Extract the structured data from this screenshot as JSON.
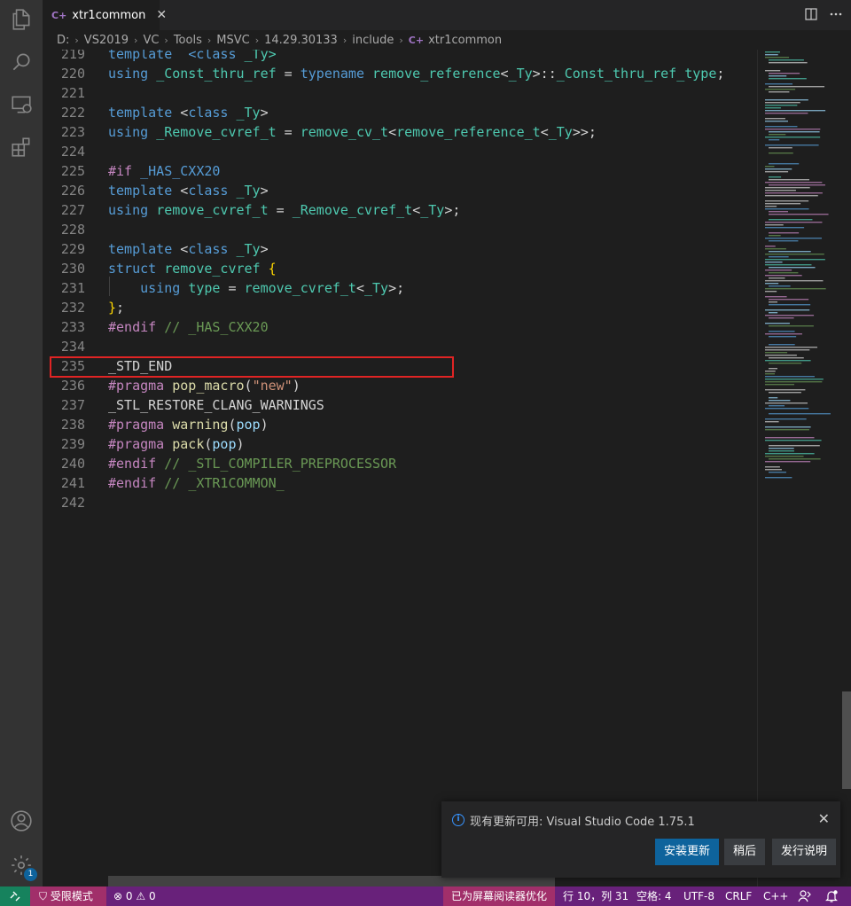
{
  "tab": {
    "icon": "c++-file-icon",
    "glyph": "C+",
    "label": "xtr1common",
    "close": "✕"
  },
  "breadcrumb": {
    "parts": [
      "D:",
      "VS2019",
      "VC",
      "Tools",
      "MSVC",
      "14.29.30133",
      "include"
    ],
    "file_glyph": "C+",
    "file": "xtr1common"
  },
  "editor": {
    "lines": [
      {
        "n": "219",
        "tokens": [
          [
            "kw",
            "template"
          ],
          [
            "",
            "  "
          ],
          [
            "kw",
            "<class"
          ],
          [
            "ty",
            " _Ty>"
          ]
        ]
      },
      {
        "n": "220",
        "tokens": [
          [
            "kw",
            "using"
          ],
          [
            "",
            " "
          ],
          [
            "ty",
            "_Const_thru_ref"
          ],
          [
            "",
            " = "
          ],
          [
            "kw",
            "typename"
          ],
          [
            "",
            " "
          ],
          [
            "ty",
            "remove_reference"
          ],
          [
            "",
            "<"
          ],
          [
            "ty",
            "_Ty"
          ],
          [
            "",
            ">::"
          ],
          [
            "ty",
            "_Const_thru_ref_type"
          ],
          [
            "",
            ";"
          ]
        ]
      },
      {
        "n": "221",
        "tokens": []
      },
      {
        "n": "222",
        "tokens": [
          [
            "kw",
            "template"
          ],
          [
            "",
            " <"
          ],
          [
            "kw",
            "class"
          ],
          [
            "",
            " "
          ],
          [
            "ty",
            "_Ty"
          ],
          [
            "",
            ">"
          ]
        ]
      },
      {
        "n": "223",
        "tokens": [
          [
            "kw",
            "using"
          ],
          [
            "",
            " "
          ],
          [
            "ty",
            "_Remove_cvref_t"
          ],
          [
            "",
            " = "
          ],
          [
            "ty",
            "remove_cv_t"
          ],
          [
            "",
            "<"
          ],
          [
            "ty",
            "remove_reference_t"
          ],
          [
            "",
            "<"
          ],
          [
            "ty",
            "_Ty"
          ],
          [
            "",
            ">>;"
          ]
        ]
      },
      {
        "n": "224",
        "tokens": []
      },
      {
        "n": "225",
        "tokens": [
          [
            "mac",
            "#if"
          ],
          [
            "",
            " "
          ],
          [
            "kw",
            "_HAS_CXX20"
          ]
        ]
      },
      {
        "n": "226",
        "tokens": [
          [
            "kw",
            "template"
          ],
          [
            "",
            " <"
          ],
          [
            "kw",
            "class"
          ],
          [
            "",
            " "
          ],
          [
            "ty",
            "_Ty"
          ],
          [
            "",
            ">"
          ]
        ]
      },
      {
        "n": "227",
        "tokens": [
          [
            "kw",
            "using"
          ],
          [
            "",
            " "
          ],
          [
            "ty",
            "remove_cvref_t"
          ],
          [
            "",
            " = "
          ],
          [
            "ty",
            "_Remove_cvref_t"
          ],
          [
            "",
            "<"
          ],
          [
            "ty",
            "_Ty"
          ],
          [
            "",
            ">;"
          ]
        ]
      },
      {
        "n": "228",
        "tokens": []
      },
      {
        "n": "229",
        "tokens": [
          [
            "kw",
            "template"
          ],
          [
            "",
            " <"
          ],
          [
            "kw",
            "class"
          ],
          [
            "",
            " "
          ],
          [
            "ty",
            "_Ty"
          ],
          [
            "",
            ">"
          ]
        ]
      },
      {
        "n": "230",
        "tokens": [
          [
            "kw",
            "struct"
          ],
          [
            "",
            " "
          ],
          [
            "ty",
            "remove_cvref"
          ],
          [
            "",
            " "
          ],
          [
            "br",
            "{"
          ]
        ]
      },
      {
        "n": "231",
        "tokens": [
          [
            "",
            "    "
          ],
          [
            "kw",
            "using"
          ],
          [
            "",
            " "
          ],
          [
            "ty",
            "type"
          ],
          [
            "",
            " = "
          ],
          [
            "ty",
            "remove_cvref_t"
          ],
          [
            "",
            "<"
          ],
          [
            "ty",
            "_Ty"
          ],
          [
            "",
            ">;"
          ]
        ]
      },
      {
        "n": "232",
        "tokens": [
          [
            "br",
            "}"
          ],
          [
            "",
            ";"
          ]
        ]
      },
      {
        "n": "233",
        "tokens": [
          [
            "mac",
            "#endif"
          ],
          [
            "",
            " "
          ],
          [
            "cm",
            "// _HAS_CXX20"
          ]
        ]
      },
      {
        "n": "234",
        "tokens": []
      },
      {
        "n": "235",
        "tokens": [
          [
            "",
            "_STD_END"
          ]
        ]
      },
      {
        "n": "236",
        "tokens": [
          [
            "mac",
            "#pragma"
          ],
          [
            "",
            " "
          ],
          [
            "fn",
            "pop_macro"
          ],
          [
            "",
            "("
          ],
          [
            "str",
            "\"new\""
          ],
          [
            "",
            ")"
          ]
        ]
      },
      {
        "n": "237",
        "tokens": [
          [
            "",
            "_STL_RESTORE_CLANG_WARNINGS"
          ]
        ]
      },
      {
        "n": "238",
        "tokens": [
          [
            "mac",
            "#pragma"
          ],
          [
            "",
            " "
          ],
          [
            "fn",
            "warning"
          ],
          [
            "",
            "("
          ],
          [
            "var",
            "pop"
          ],
          [
            "",
            ")"
          ]
        ]
      },
      {
        "n": "239",
        "tokens": [
          [
            "mac",
            "#pragma"
          ],
          [
            "",
            " "
          ],
          [
            "fn",
            "pack"
          ],
          [
            "",
            "("
          ],
          [
            "var",
            "pop"
          ],
          [
            "",
            ")"
          ]
        ]
      },
      {
        "n": "240",
        "tokens": [
          [
            "mac",
            "#endif"
          ],
          [
            "",
            " "
          ],
          [
            "cm",
            "// "
          ],
          [
            "cm",
            "_STL_COMPILER_PREPROCESSOR"
          ]
        ]
      },
      {
        "n": "241",
        "tokens": [
          [
            "mac",
            "#endif"
          ],
          [
            "",
            " "
          ],
          [
            "cm",
            "// "
          ],
          [
            "cm",
            "_XTR1COMMON_"
          ]
        ]
      },
      {
        "n": "242",
        "tokens": []
      }
    ]
  },
  "notification": {
    "icon": "info-icon",
    "message": "现有更新可用: Visual Studio Code 1.75.1",
    "close": "✕",
    "buttons": {
      "install": "安装更新",
      "later": "稍后",
      "notes": "发行说明"
    }
  },
  "activity": {
    "settings_badge": "1"
  },
  "status": {
    "restricted": "受限模式",
    "errors": "0",
    "warnings": "0",
    "screen_reader": "已为屏幕阅读器优化",
    "position": "行 10，列 31",
    "spaces": "空格: 4",
    "encoding": "UTF-8",
    "eol": "CRLF",
    "language": "C++"
  },
  "colors": {
    "status_bar": "#68217a",
    "remote": "#16825d",
    "restricted": "#a12f6a",
    "primary_button": "#0e639c",
    "highlight_box": "#e02424"
  }
}
